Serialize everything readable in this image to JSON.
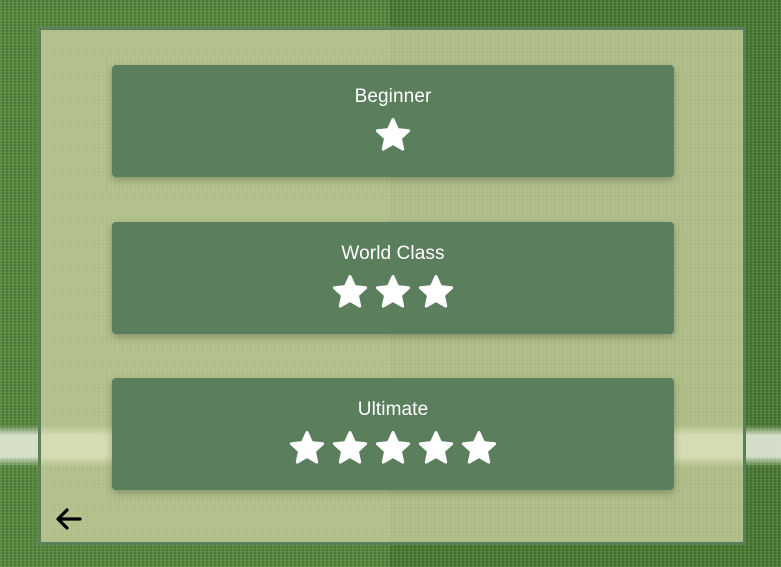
{
  "levels": [
    {
      "label": "Beginner",
      "stars": 1
    },
    {
      "label": "World Class",
      "stars": 3
    },
    {
      "label": "Ultimate",
      "stars": 5
    }
  ],
  "icons": {
    "star": "star-icon",
    "back": "arrow-left-icon"
  },
  "colors": {
    "card": "#5b7e5d",
    "panel_border": "#5a7f5b",
    "star": "#ffffff",
    "arrow": "#000000"
  }
}
